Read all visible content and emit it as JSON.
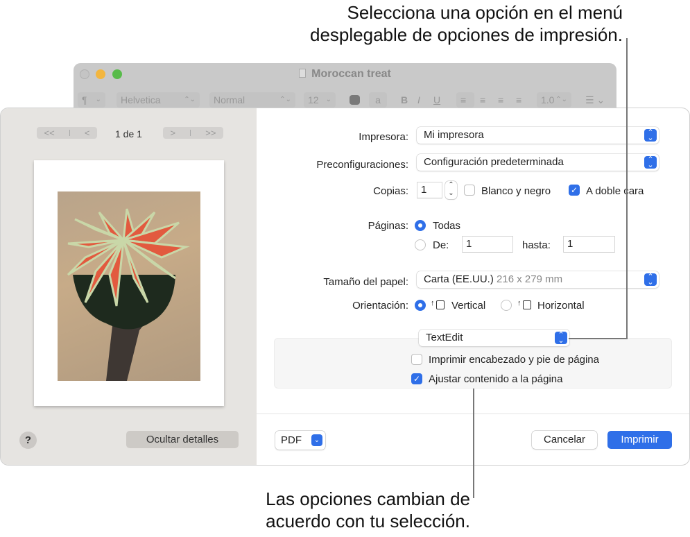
{
  "callouts": {
    "top_line1": "Selecciona una opción en el menú",
    "top_line2": "desplegable de opciones de impresión.",
    "bottom_line1": "Las opciones cambian de",
    "bottom_line2": "acuerdo con tu selección."
  },
  "background_window": {
    "title": "Moroccan treat",
    "toolbar": {
      "paragraph_style": "¶",
      "font_family": "Helvetica",
      "font_style": "Normal",
      "font_size": "12",
      "bold": "B",
      "italic": "I",
      "underline": "U",
      "line_spacing": "1.0",
      "list_icon": "list-icon"
    }
  },
  "preview": {
    "first_page": "<<",
    "prev_page": "<",
    "page_count": "1 de 1",
    "next_page": ">",
    "last_page": ">>",
    "help_label": "?",
    "hide_details_label": "Ocultar detalles"
  },
  "form": {
    "printer_label": "Impresora:",
    "printer_value": "Mi impresora",
    "presets_label": "Preconfiguraciones:",
    "presets_value": "Configuración predeterminada",
    "copies_label": "Copias:",
    "copies_value": "1",
    "bw_label": "Blanco y negro",
    "bw_checked": false,
    "duplex_label": "A doble cara",
    "duplex_checked": true,
    "pages_label": "Páginas:",
    "pages_all_label": "Todas",
    "pages_all_selected": true,
    "pages_from_label": "De:",
    "pages_from_value": "1",
    "pages_to_label": "hasta:",
    "pages_to_value": "1",
    "paper_size_label": "Tamaño del papel:",
    "paper_size_value": "Carta (EE.UU.)",
    "paper_size_dims": "216 x 279 mm",
    "orientation_label": "Orientación:",
    "orientation_portrait_label": "Vertical",
    "orientation_landscape_label": "Horizontal",
    "orientation_selected": "Vertical",
    "app_menu_value": "TextEdit",
    "header_footer_label": "Imprimir encabezado y pie de página",
    "header_footer_checked": false,
    "fit_content_label": "Ajustar contenido a la página",
    "fit_content_checked": true
  },
  "footer": {
    "pdf_label": "PDF",
    "cancel_label": "Cancelar",
    "print_label": "Imprimir"
  },
  "colors": {
    "accent": "#2f6fe8",
    "sidebar_bg": "#e6e4e1",
    "traffic_yellow": "#f3b63f",
    "traffic_green": "#58bb4a"
  }
}
